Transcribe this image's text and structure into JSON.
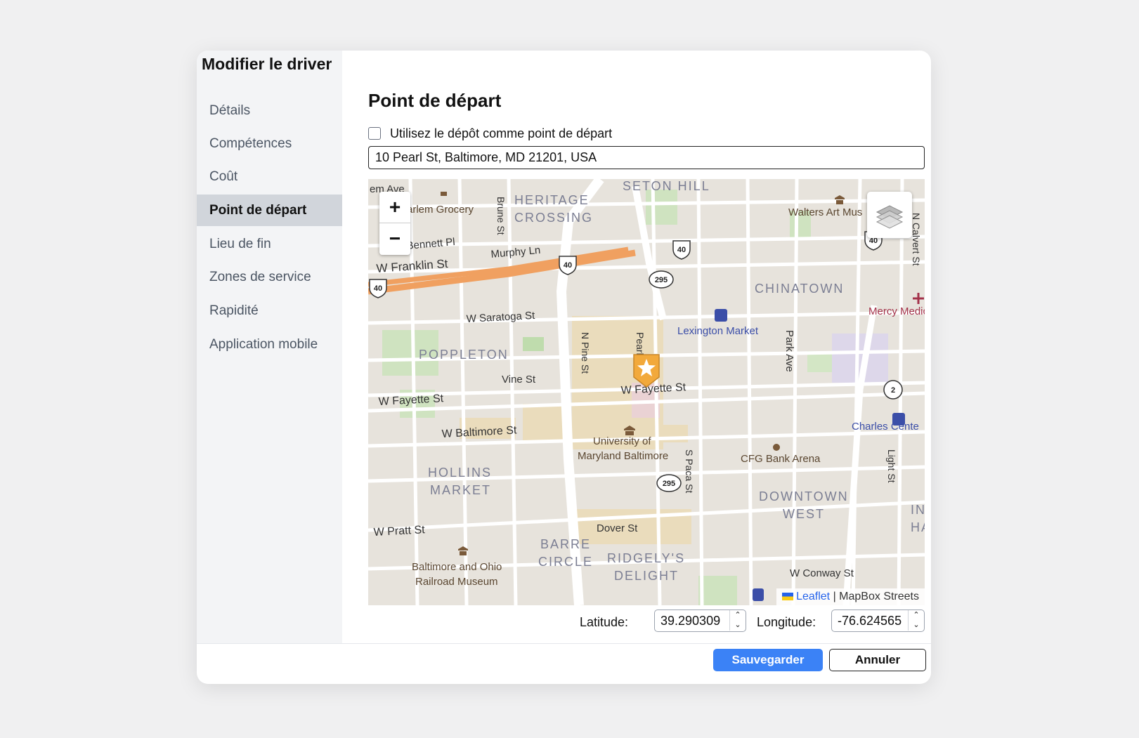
{
  "dialog": {
    "title": "Modifier le driver"
  },
  "sidebar": {
    "items": [
      {
        "label": "Détails",
        "active": false
      },
      {
        "label": "Compétences",
        "active": false
      },
      {
        "label": "Coût",
        "active": false
      },
      {
        "label": "Point de départ",
        "active": true
      },
      {
        "label": "Lieu de fin",
        "active": false
      },
      {
        "label": "Zones de service",
        "active": false
      },
      {
        "label": "Rapidité",
        "active": false
      },
      {
        "label": "Application mobile",
        "active": false
      }
    ]
  },
  "main": {
    "title": "Point de départ",
    "use_depot_label": "Utilisez le dépôt comme point de départ",
    "use_depot_checked": false,
    "address": "10 Pearl St, Baltimore, MD 21201, USA"
  },
  "map": {
    "zoom_in": "+",
    "zoom_out": "−",
    "layers_icon": "layers-icon",
    "marker_icon": "star-marker-icon",
    "attribution": {
      "leaflet": "Leaflet",
      "separator": " | ",
      "tiles": "MapBox Streets"
    },
    "labels": {
      "em_ave": "em Ave",
      "harlem_grocery": "arlem Grocery",
      "heritage": "HERITAGE",
      "crossing": "CROSSING",
      "seton_hill": "SETON HILL",
      "brune_st": "Brune St",
      "walters": "Walters Art Mus",
      "n_calvert": "N Calvert St",
      "bennett_pl": "Bennett Pl",
      "murphy_ln": "Murphy Ln",
      "w_franklin": "W Franklin St",
      "chinatown": "CHINATOWN",
      "mercy": "Mercy Medic",
      "w_saratoga": "W Saratoga St",
      "lexington": "Lexington Market",
      "poppleton": "POPPLETON",
      "n_pine": "N Pine St",
      "pearl": "Pearl",
      "park_ave": "Park Ave",
      "vine_st": "Vine St",
      "w_fayette_left": "W Fayette St",
      "w_fayette_mid": "W Fayette St",
      "charles_center": "Charles Cente",
      "w_baltimore": "W Baltimore St",
      "umb1": "University of",
      "umb2": "Maryland Baltimore",
      "cfg": "CFG Bank Arena",
      "hollins": "HOLLINS",
      "market": "MARKET",
      "s_paca": "S Paca St",
      "light_st": "Light St",
      "downtown": "DOWNTOWN",
      "west": "WEST",
      "inner_in": "IN",
      "inner_ha": "HA",
      "w_pratt": "W Pratt St",
      "dover": "Dover St",
      "barre": "BARRE",
      "circle": "CIRCLE",
      "ridgelys": "RIDGELY'S",
      "delight": "DELIGHT",
      "bo1": "Baltimore and Ohio",
      "bo2": "Railroad Museum",
      "w_conway": "W Conway St"
    },
    "shields": {
      "us40": "40",
      "i295": "295",
      "md2": "2"
    }
  },
  "coords": {
    "lat_label": "Latitude:",
    "lat_value": "39.290309",
    "lng_label": "Longitude:",
    "lng_value": "-76.624565"
  },
  "footer": {
    "save_label": "Sauvegarder",
    "cancel_label": "Annuler"
  },
  "colors": {
    "accent": "#3b82f6",
    "highway": "#f0a060",
    "marker": "#f2a93b"
  }
}
